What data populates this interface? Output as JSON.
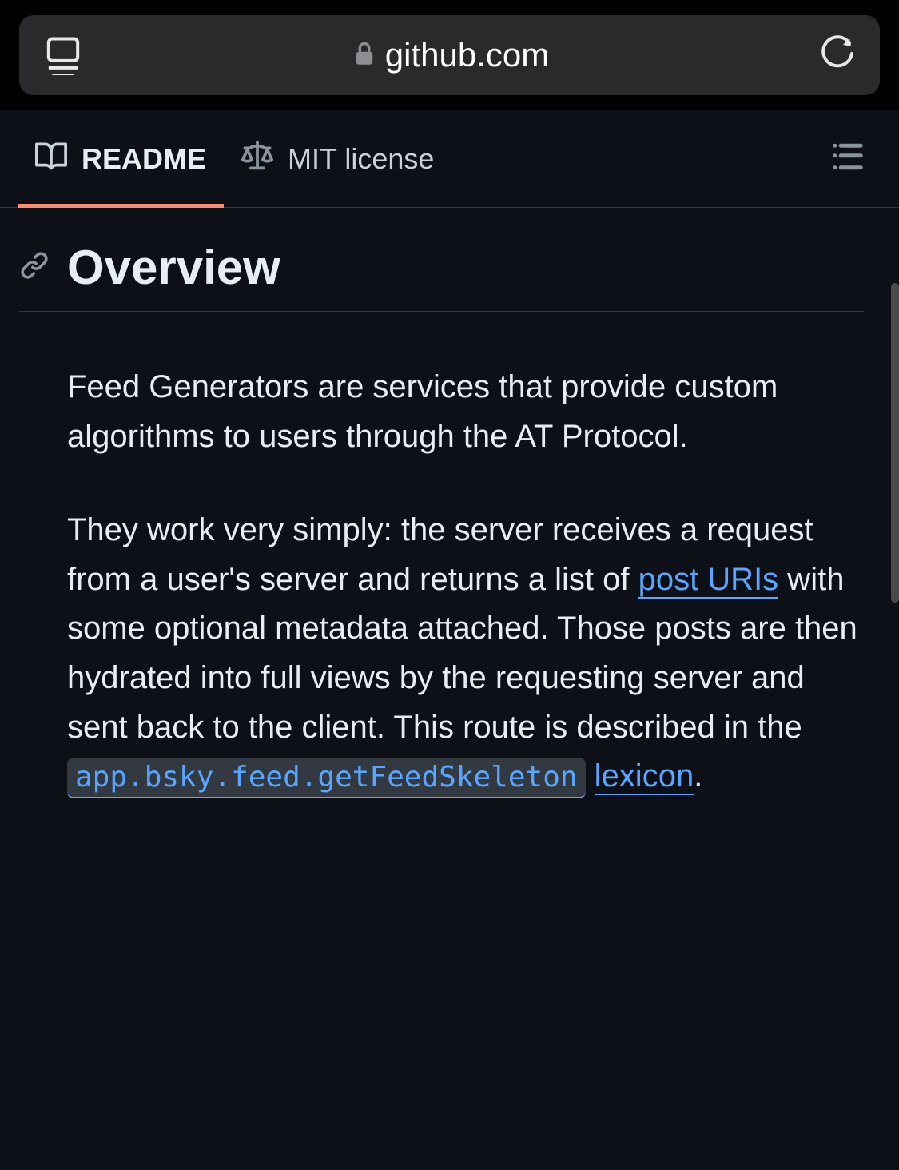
{
  "browser": {
    "domain": "github.com"
  },
  "tabs": {
    "readme": "README",
    "license": "MIT license"
  },
  "heading": "Overview",
  "para1": "Feed Generators are services that provide custom algorithms to users through the AT Protocol.",
  "para2": {
    "a": "They work very simply: the server receives a request from a user's server and returns a list of ",
    "link1": "post URIs",
    "b": " with some optional metadata attached. Those posts are then hydrated into full views by the requesting server and sent back to the client. This route is described in the ",
    "code": "app.bsky.feed.getFeedSkeleton",
    "link2": "lexicon",
    "c": "."
  }
}
